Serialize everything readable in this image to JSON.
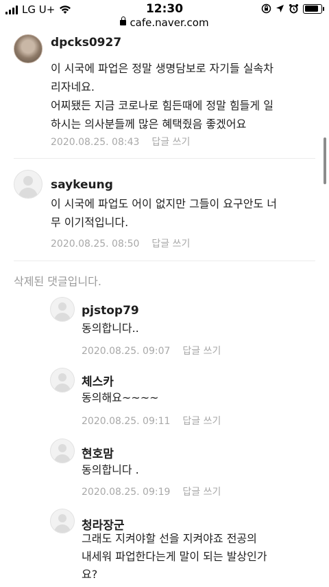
{
  "status_bar": {
    "carrier": "LG U+",
    "time": "12:30"
  },
  "url_bar": {
    "domain": "cafe.naver.com"
  },
  "comments": [
    {
      "author": "dpcks0927",
      "lines": [
        "이 시국에 파업은 정말 생명담보로 자기들 실속차",
        "리자네요.",
        "어찌됐든 지금 코로나로 힘든때에 정말 힘들게 일",
        "하시는 의사분들께 많은 혜택줬음 좋겠어요"
      ],
      "date": "2020.08.25. 08:43",
      "reply": "답글 쓰기"
    },
    {
      "author": "saykeung",
      "lines": [
        "이 시국에 파업도 어이 없지만 그들이 요구안도 너",
        "무 이기적입니다."
      ],
      "date": "2020.08.25. 08:50",
      "reply": "답글 쓰기"
    }
  ],
  "deleted_notice": "삭제된 댓글입니다.",
  "replies": [
    {
      "author": "pjstop79",
      "lines": [
        "동의합니다.."
      ],
      "date": "2020.08.25. 09:07",
      "reply": "답글 쓰기"
    },
    {
      "author": "체스카",
      "lines": [
        "동의해요~~~~"
      ],
      "date": "2020.08.25. 09:11",
      "reply": "답글 쓰기"
    },
    {
      "author": "현호맘",
      "lines": [
        "동의합니다 ."
      ],
      "date": "2020.08.25. 09:19",
      "reply": "답글 쓰기"
    },
    {
      "author": "청라장군",
      "lines": [
        "그래도 지켜야할 선을 지켜야죠 전공의",
        "내세워 파업한다는게 말이 되는 발상인가",
        "요?"
      ]
    }
  ]
}
